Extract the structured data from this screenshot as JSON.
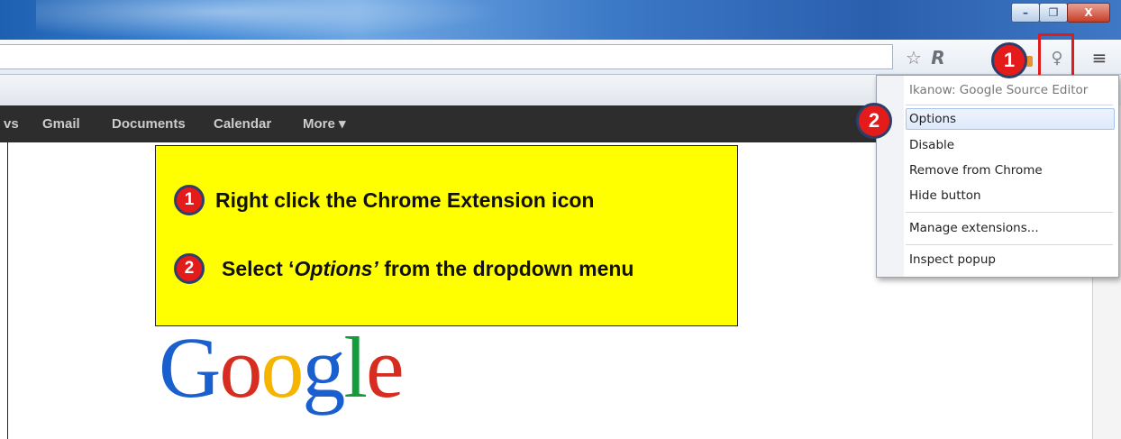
{
  "window": {
    "minimize_glyph": "–",
    "restore_glyph": "❐",
    "close_glyph": "X"
  },
  "toolbar": {
    "star_icon_glyph": "☆",
    "r_icon_glyph": "R",
    "extension_icon_glyph": "♀",
    "menu_icon_glyph": "≡"
  },
  "gbar": {
    "items": [
      "vs",
      "Gmail",
      "Documents",
      "Calendar",
      "More ▾"
    ]
  },
  "context_menu": {
    "title": "Ikanow: Google Source Editor",
    "items": [
      "Options",
      "Disable",
      "Remove from Chrome",
      "Hide button",
      "Manage extensions...",
      "Inspect popup"
    ]
  },
  "callout": {
    "step1_number": "1",
    "step1_text": "Right click the Chrome Extension icon",
    "step2_number": "2",
    "step2_text_pre": "Select ‘",
    "step2_text_em": "Options’",
    "step2_text_post": " from the dropdown menu"
  },
  "annotation_badges": {
    "toolbar_badge": "1",
    "menu_badge": "2"
  },
  "logo": {
    "letters": [
      "G",
      "o",
      "o",
      "g",
      "l",
      "e"
    ],
    "colors": [
      "#1a5fd0",
      "#d62d20",
      "#f4b400",
      "#1a5fd0",
      "#139b3c",
      "#d62d20"
    ]
  }
}
